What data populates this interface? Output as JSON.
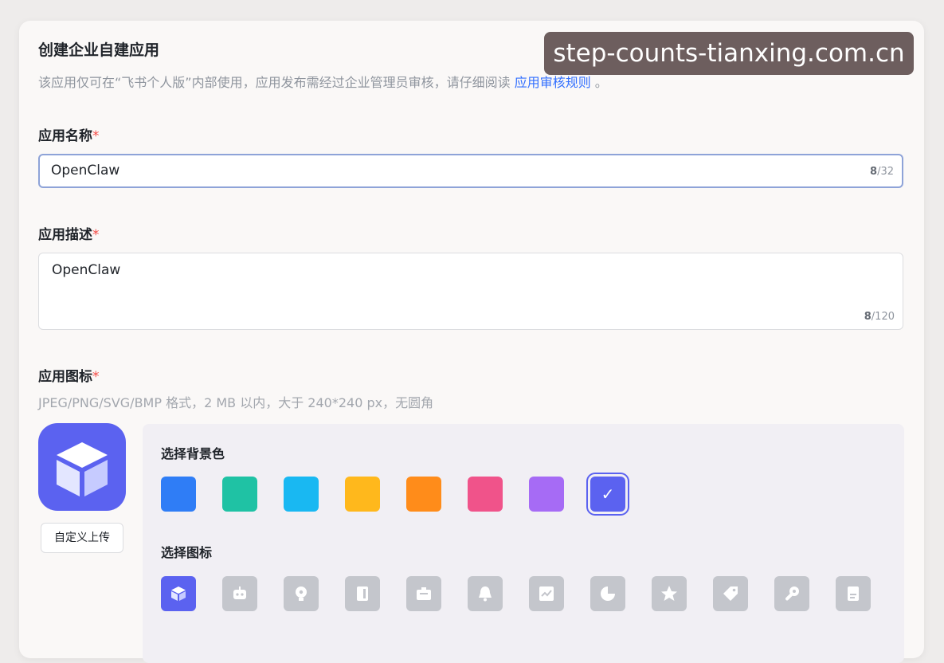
{
  "dialog": {
    "title": "创建企业自建应用",
    "subtitle_text": "该应用仅可在“飞书个人版”内部使用，应用发布需经过企业管理员审核，请仔细阅读",
    "subtitle_link": "应用审核规则",
    "subtitle_end": "。"
  },
  "name_field": {
    "label": "应用名称",
    "required_mark": "*",
    "value": "OpenClaw",
    "count": "8",
    "max": "/32"
  },
  "desc_field": {
    "label": "应用描述",
    "required_mark": "*",
    "value": "OpenClaw",
    "count": "8",
    "max": "/120"
  },
  "icon_field": {
    "label": "应用图标",
    "required_mark": "*",
    "hint": "JPEG/PNG/SVG/BMP 格式，2 MB 以内，大于 240*240 px，无圆角",
    "upload_label": "自定义上传",
    "bg_title": "选择背景色",
    "icon_title": "选择图标",
    "selected_color": "#5b62f0",
    "bg_colors": [
      "#2f7df6",
      "#1fc2a4",
      "#19b8f2",
      "#ffb81c",
      "#ff8c1a",
      "#f0538a",
      "#a66bf5",
      "#5b62f0"
    ],
    "icons": [
      "cube-icon",
      "robot-icon",
      "bulb-icon",
      "book-icon",
      "briefcase-icon",
      "bell-icon",
      "chart-icon",
      "pie-chart-icon",
      "star-icon",
      "tag-icon",
      "wrench-icon",
      "document-icon"
    ]
  },
  "watermark": "step-counts-tianxing.com.cn"
}
